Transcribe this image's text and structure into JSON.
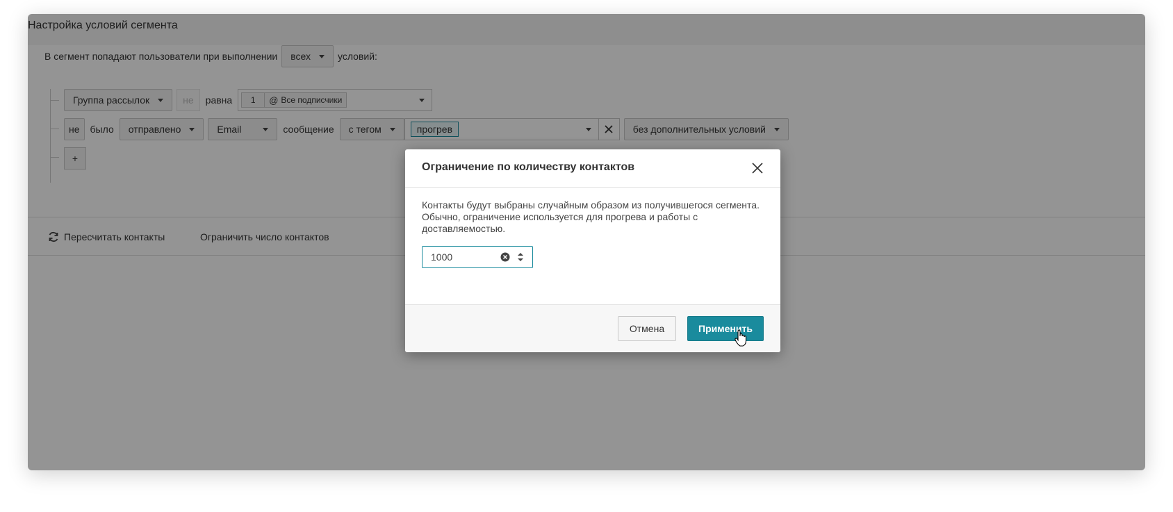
{
  "panel": {
    "title": "Настройка условий сегмента",
    "intro_text": "В сегмент попадают пользователи при выполнении",
    "match_select": "всех",
    "intro_suffix": "условий:",
    "rule1": {
      "field": "Группа рассылок",
      "negation": "не",
      "operator": "равна",
      "group_count": "1",
      "group_name": "Все подписчики"
    },
    "rule2": {
      "negation": "не",
      "verb": "было",
      "status": "отправлено",
      "channel": "Email",
      "object": "сообщение",
      "filter": "с тегом",
      "tag": "прогрев",
      "extra": "без дополнительных условий"
    },
    "add_button": "+",
    "actions": {
      "recalculate": "Пересчитать контакты",
      "limit": "Ограничить число контактов"
    }
  },
  "modal": {
    "title": "Ограничение по количеству контактов",
    "description": "Контакты будут выбраны случайным образом из получившегося сегмента. Обычно, ограничение используется для прогрева и работы с доставляемостью.",
    "limit_value": "1000",
    "cancel_label": "Отмена",
    "apply_label": "Применить"
  },
  "colors": {
    "accent": "#1a8b9d",
    "overlay": "rgba(0,0,0,0.42)"
  },
  "icons": {
    "close": "close-icon",
    "refresh": "refresh-icon",
    "clear": "clear-icon",
    "spinner": "spinner-icon",
    "cursor": "hand-cursor-icon"
  }
}
